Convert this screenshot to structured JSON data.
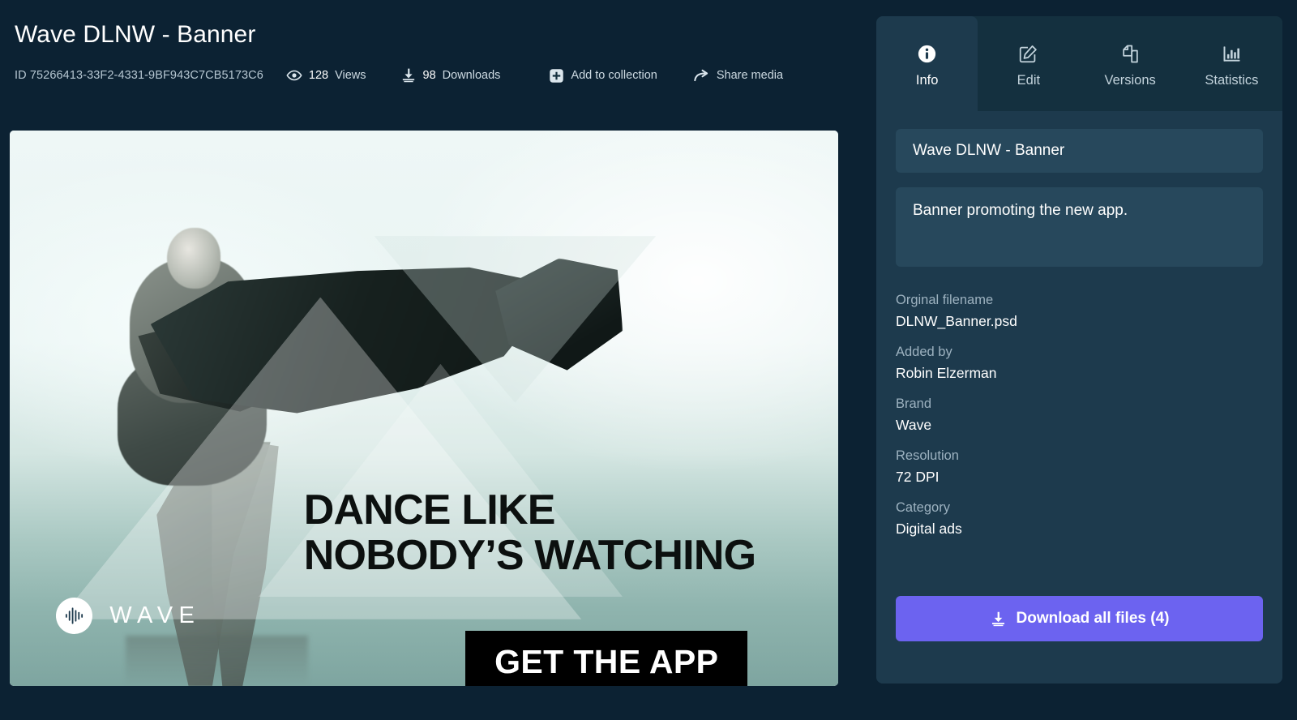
{
  "header": {
    "title": "Wave DLNW - Banner",
    "id_text": "ID 75266413-33F2-4331-9BF943C7CB5173C6",
    "views_count": "128",
    "views_label": "Views",
    "downloads_count": "98",
    "downloads_label": "Downloads",
    "add_to_collection_label": "Add to collection",
    "share_media_label": "Share media",
    "icons": {
      "views": "eye-icon",
      "downloads": "download-icon",
      "add_to_collection": "plus-square-icon",
      "share": "share-arrow-icon"
    }
  },
  "banner": {
    "headline_line1": "DANCE LIKE",
    "headline_line2": "NOBODY’S WATCHING",
    "cta_label": "GET THE APP",
    "logo_word": "WAVE",
    "logo_icon": "waveform-circle-icon"
  },
  "panel": {
    "tabs": [
      {
        "label": "Info",
        "icon": "info-circle-icon",
        "active": true
      },
      {
        "label": "Edit",
        "icon": "pencil-square-icon",
        "active": false
      },
      {
        "label": "Versions",
        "icon": "copy-pages-icon",
        "active": false
      },
      {
        "label": "Statistics",
        "icon": "bar-chart-icon",
        "active": false
      }
    ],
    "title_value": "Wave DLNW - Banner",
    "description_value": "Banner promoting the new app.",
    "fields": [
      {
        "label": "Orginal filename",
        "value": "DLNW_Banner.psd"
      },
      {
        "label": "Added by",
        "value": "Robin Elzerman"
      },
      {
        "label": "Brand",
        "value": "Wave"
      },
      {
        "label": "Resolution",
        "value": "72 DPI"
      },
      {
        "label": "Category",
        "value": "Digital ads"
      }
    ],
    "download_button_label": "Download all files (4)",
    "download_button_icon": "download-icon"
  },
  "colors": {
    "page_background": "#0c2233",
    "panel_background": "#1d3a4d",
    "tabstrip_background": "#14303f",
    "field_background": "#27485c",
    "accent_button": "#6c63f0",
    "text_primary": "#ffffff",
    "text_muted": "#9db2c0"
  }
}
